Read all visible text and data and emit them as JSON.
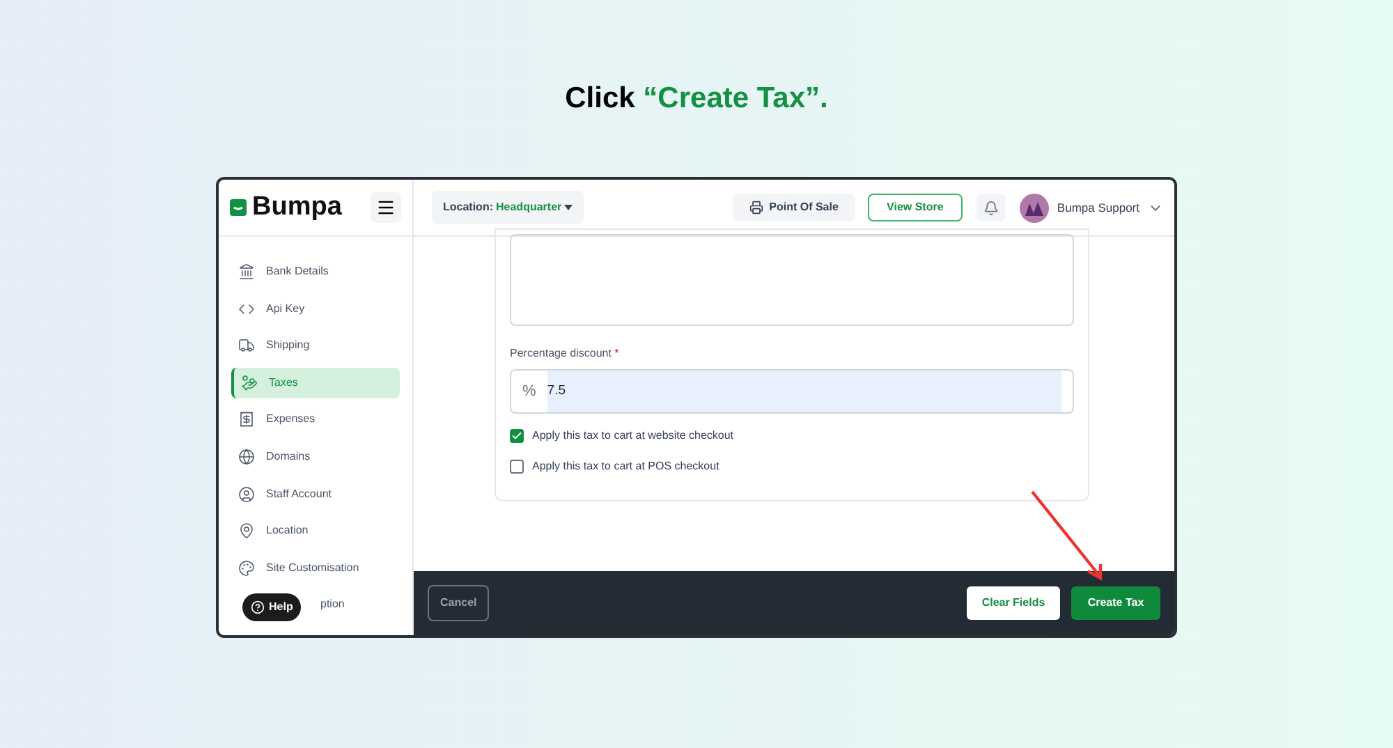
{
  "instruction": {
    "prefix": "Click ",
    "highlight": "“Create Tax”."
  },
  "header": {
    "brand": "Bumpa",
    "location_label": "Location:",
    "location_value": "Headquarter",
    "pos_button": "Point Of Sale",
    "view_store_button": "View Store",
    "user_name": "Bumpa Support"
  },
  "sidebar": {
    "items": [
      {
        "label": "Bank Details",
        "selected": false
      },
      {
        "label": "Api Key",
        "selected": false
      },
      {
        "label": "Shipping",
        "selected": false
      },
      {
        "label": "Taxes",
        "selected": true
      },
      {
        "label": "Expenses",
        "selected": false
      },
      {
        "label": "Domains",
        "selected": false
      },
      {
        "label": "Staff Account",
        "selected": false
      },
      {
        "label": "Location",
        "selected": false
      },
      {
        "label": "Site Customisation",
        "selected": false
      },
      {
        "label": "ption",
        "selected": false
      }
    ],
    "help_button": "Help"
  },
  "form": {
    "discount_label": "Percentage discount",
    "required_mark": "*",
    "discount_prefix": "%",
    "discount_value": "7.5",
    "options": [
      {
        "label": "Apply this tax to cart at website checkout",
        "checked": true
      },
      {
        "label": "Apply this tax to cart at POS checkout",
        "checked": false
      }
    ]
  },
  "footer": {
    "cancel": "Cancel",
    "clear": "Clear Fields",
    "create": "Create Tax"
  }
}
